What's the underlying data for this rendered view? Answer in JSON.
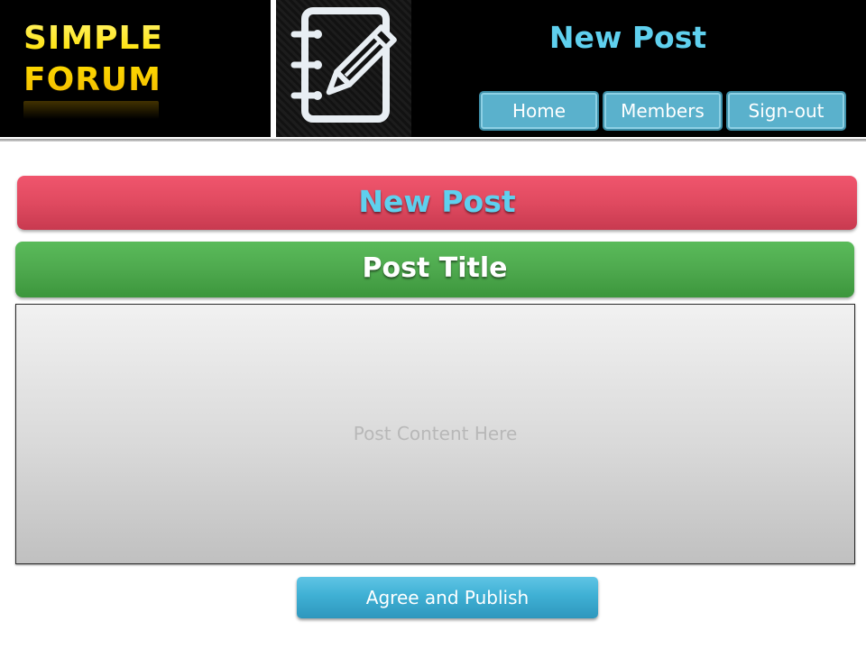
{
  "header": {
    "logo_line1": "SIMPLE",
    "logo_line2": "FORUM",
    "page_heading": "New Post",
    "icon": "notebook-pencil-icon",
    "nav": [
      {
        "label": "Home"
      },
      {
        "label": "Members"
      },
      {
        "label": "Sign-out"
      }
    ]
  },
  "main": {
    "banner_title": "New Post",
    "post_title_label": "Post Title",
    "content_placeholder": "Post Content Here",
    "publish_label": "Agree and Publish"
  },
  "colors": {
    "logo_text": "#ffe400",
    "heading_text": "#5fd0ee",
    "nav_button": "#5ab1cc",
    "red_banner": "#e04a60",
    "green_banner": "#4ea94e",
    "publish_button": "#3fb0d4"
  }
}
